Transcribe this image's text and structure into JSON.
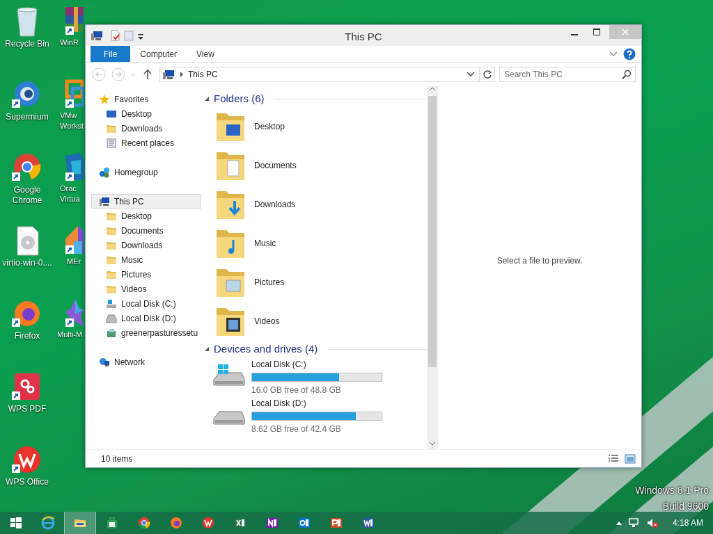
{
  "desktop": {
    "columns": [
      [
        {
          "label": "Recycle Bin"
        },
        {
          "label": "Supermium"
        },
        {
          "label": "Google Chrome"
        },
        {
          "label": "virtio-win-0...."
        },
        {
          "label": "Firefox"
        },
        {
          "label": "WPS PDF"
        },
        {
          "label": "WPS Office"
        }
      ],
      [
        {
          "label": "WinR"
        },
        {
          "label": "VMw Workst"
        },
        {
          "label": "Orac Virtua"
        },
        {
          "label": "MEr"
        },
        {
          "label": "Multi-M"
        }
      ]
    ],
    "edition": "Windows 8.1 Pro",
    "build": "Build 9600"
  },
  "window": {
    "title": "This PC",
    "ribbon_tabs": [
      {
        "label": "File",
        "selected": true
      },
      {
        "label": "Computer",
        "selected": false
      },
      {
        "label": "View",
        "selected": false
      }
    ],
    "address": {
      "path": "This PC"
    },
    "search": {
      "placeholder": "Search This PC"
    },
    "navigation_pane": {
      "groups": [
        {
          "label": "Favorites",
          "selected": false,
          "children": [
            {
              "label": "Desktop",
              "selected": false
            },
            {
              "label": "Downloads",
              "selected": false
            },
            {
              "label": "Recent places",
              "selected": false
            }
          ]
        },
        {
          "label": "Homegroup",
          "selected": false
        },
        {
          "label": "This PC",
          "selected": true,
          "children": [
            {
              "label": "Desktop",
              "selected": false
            },
            {
              "label": "Documents",
              "selected": false
            },
            {
              "label": "Downloads",
              "selected": false
            },
            {
              "label": "Music",
              "selected": false
            },
            {
              "label": "Pictures",
              "selected": false
            },
            {
              "label": "Videos",
              "selected": false
            },
            {
              "label": "Local Disk (C:)",
              "selected": false
            },
            {
              "label": "Local Disk (D:)",
              "selected": false
            },
            {
              "label": "greenerpasturessetu",
              "selected": false
            }
          ]
        },
        {
          "label": "Network",
          "selected": false
        }
      ]
    },
    "sections": [
      {
        "title": "Folders (6)",
        "expanded": true,
        "kind": "folders",
        "items": [
          {
            "label": "Desktop"
          },
          {
            "label": "Documents"
          },
          {
            "label": "Downloads"
          },
          {
            "label": "Music"
          },
          {
            "label": "Pictures"
          },
          {
            "label": "Videos"
          }
        ]
      },
      {
        "title": "Devices and drives (4)",
        "expanded": true,
        "kind": "drives",
        "items": [
          {
            "label": "Local Disk (C:)",
            "level": 0.67,
            "reading": "16.0 GB free of 48.8 GB"
          },
          {
            "label": "Local Disk (D:)",
            "level": 0.8,
            "reading": "8.62 GB free of 42.4 GB"
          }
        ]
      }
    ],
    "preview": "Select a file to preview.",
    "status_bar": {
      "count": "10 items"
    }
  },
  "taskbar": {
    "pinned": [
      {
        "selected": false
      },
      {
        "selected": true
      },
      {
        "selected": false
      },
      {
        "selected": false
      },
      {
        "selected": false
      },
      {
        "selected": false
      },
      {
        "selected": false
      },
      {
        "selected": false
      },
      {
        "selected": false
      },
      {
        "selected": false
      },
      {
        "selected": false
      }
    ],
    "clock": "4:18 AM"
  }
}
